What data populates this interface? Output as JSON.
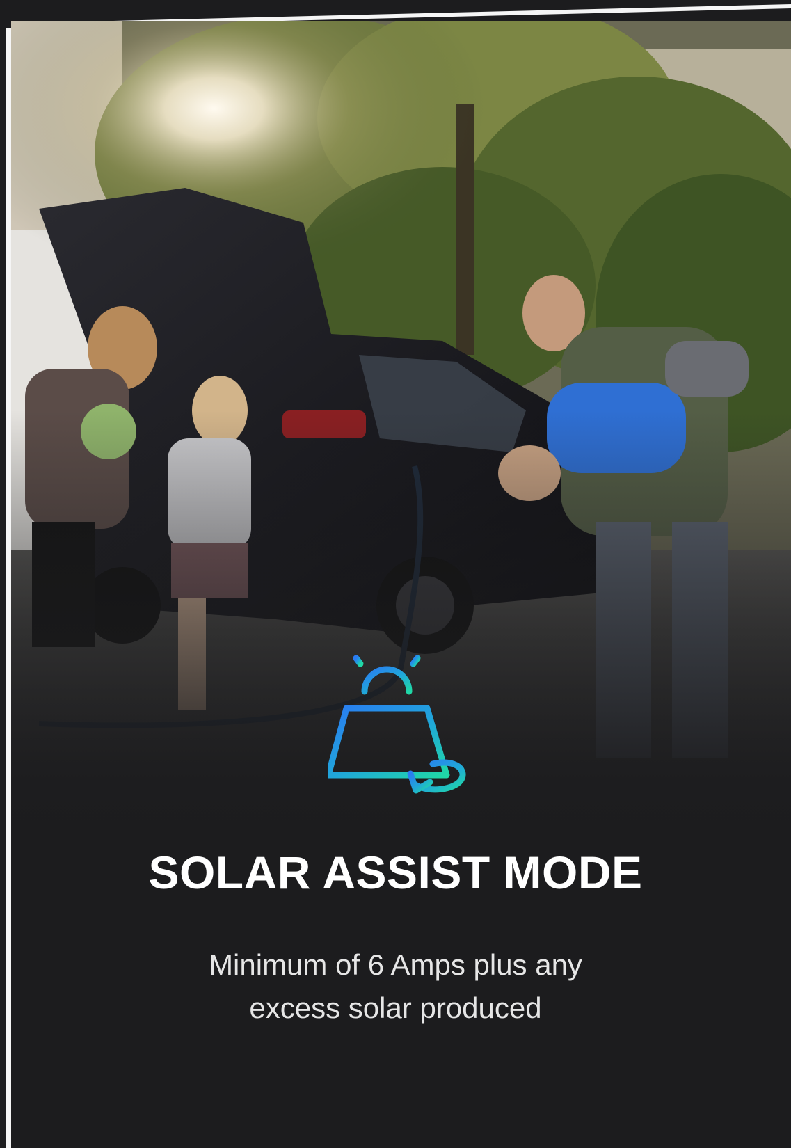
{
  "card": {
    "title": "SOLAR ASSIST MODE",
    "description_line1": "Minimum of 6 Amps plus any",
    "description_line2": "excess solar produced"
  },
  "icons": {
    "feature_icon": "solar-panel-sun-icon"
  },
  "colors": {
    "background": "#1c1c1e",
    "title": "#ffffff",
    "icon_gradient_start": "#2a7bf2",
    "icon_gradient_end": "#20d8a6"
  }
}
